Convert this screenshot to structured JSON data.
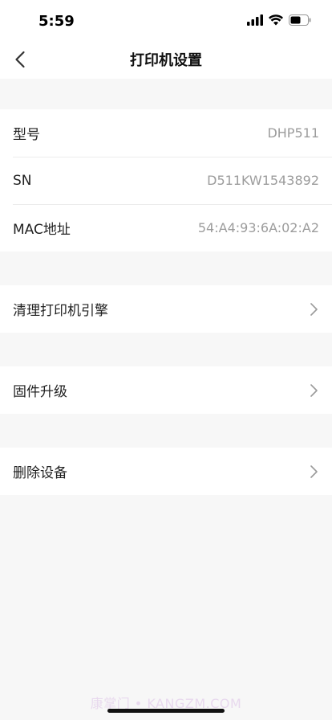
{
  "status_bar": {
    "time": "5:59"
  },
  "nav": {
    "title": "打印机设置"
  },
  "info": {
    "model_label": "型号",
    "model_value": "DHP511",
    "sn_label": "SN",
    "sn_value": "D511KW1543892",
    "mac_label": "MAC地址",
    "mac_value": "54:A4:93:6A:02:A2"
  },
  "actions": {
    "clean_engine": "清理打印机引擎",
    "firmware_upgrade": "固件升级",
    "delete_device": "删除设备"
  },
  "watermark": "康掌门 • KANGZM.COM",
  "colors": {
    "background": "#f7f7f7",
    "card": "#ffffff",
    "value_gray": "#9c9c9c"
  }
}
